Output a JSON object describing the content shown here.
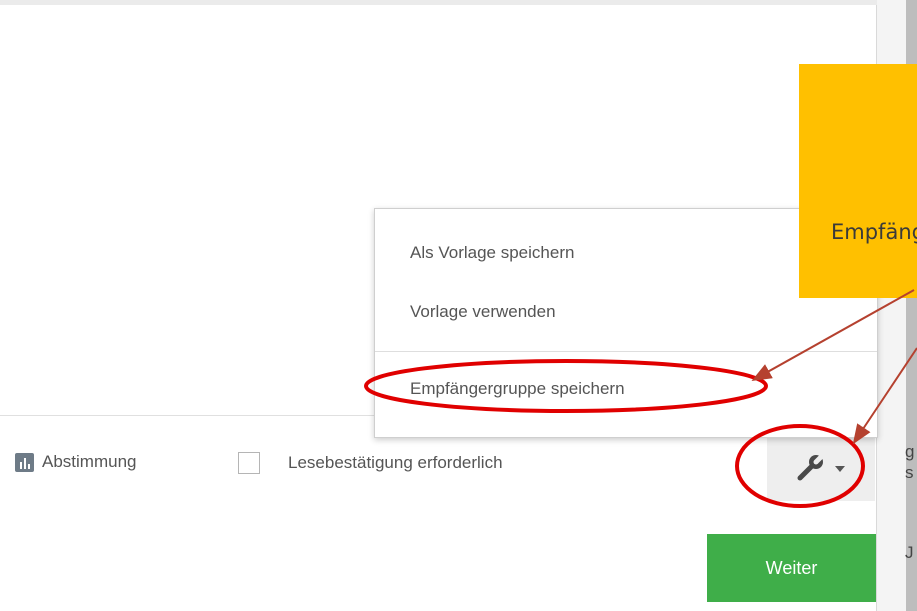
{
  "callout": {
    "text": "Empfängergruppe speichern"
  },
  "menu": {
    "items": [
      {
        "label": "Als Vorlage speichern"
      },
      {
        "label": "Vorlage verwenden"
      },
      {
        "label": "Empfängergruppe speichern"
      }
    ]
  },
  "toolbar": {
    "poll_label": "Abstimmung",
    "receipt_label": "Lesebestätigung erforderlich",
    "receipt_checked": false,
    "tools_icon": "wrench-icon"
  },
  "actions": {
    "next_label": "Weiter"
  },
  "right_strip": {
    "fragments": [
      "g",
      "s",
      "J"
    ]
  },
  "colors": {
    "callout": "#ffc000",
    "highlight": "#e00000",
    "arrow": "#b5412f",
    "next_button": "#3fae49"
  }
}
